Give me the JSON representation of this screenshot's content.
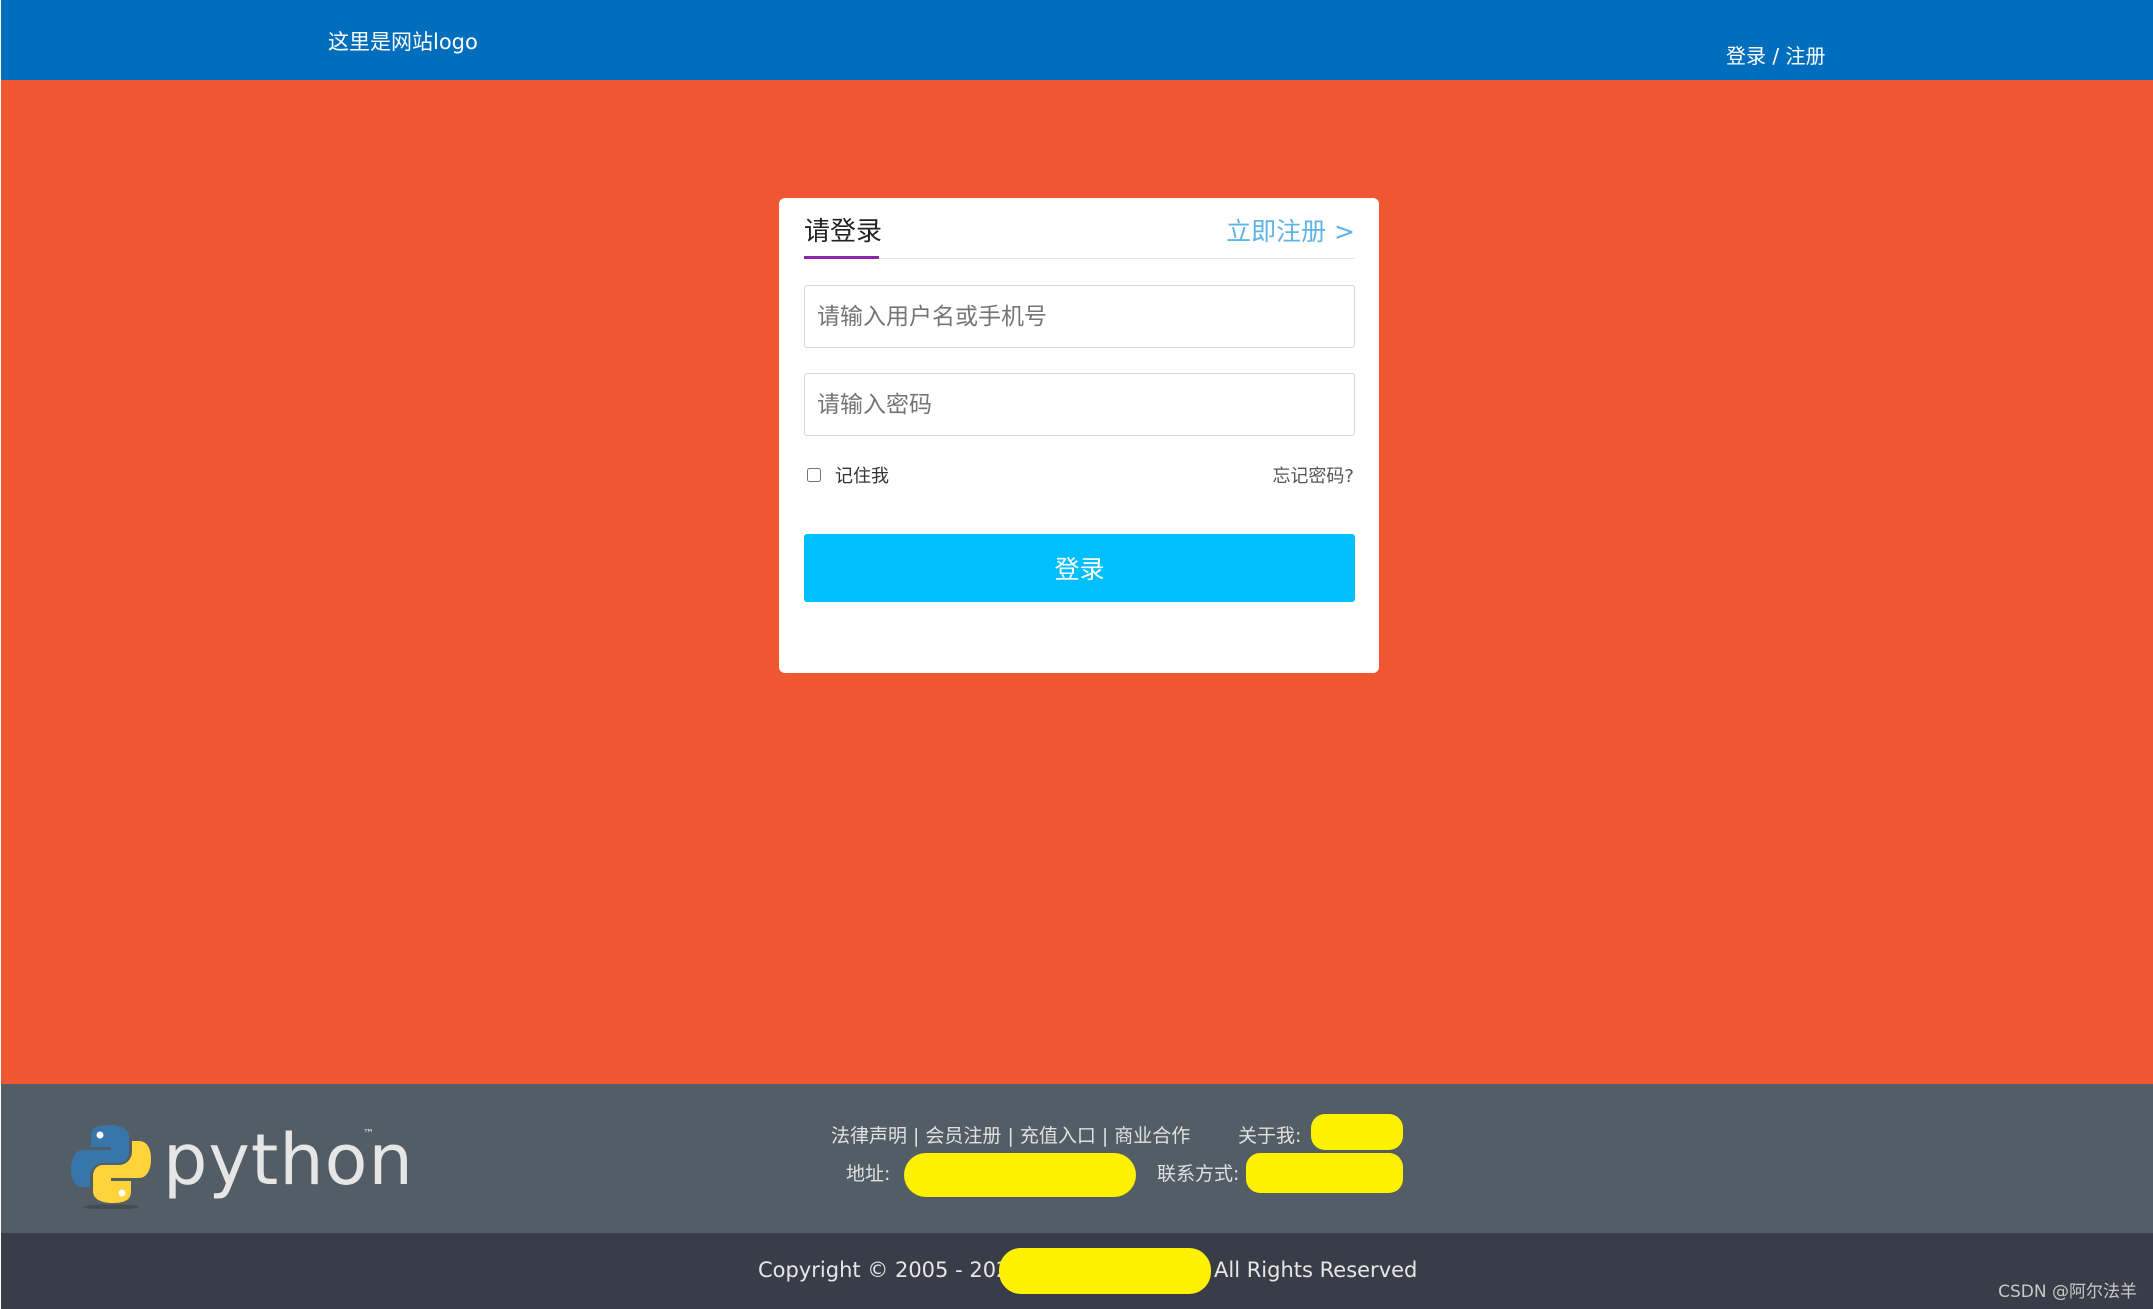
{
  "header": {
    "logo_text": "这里是网站logo",
    "login_link": "登录",
    "link_separator": " / ",
    "register_link": "注册"
  },
  "login_card": {
    "tab_login": "请登录",
    "tab_register": "立即注册 >",
    "username_placeholder": "请输入用户名或手机号",
    "password_placeholder": "请输入密码",
    "remember_label": "记住我",
    "forgot_link": "忘记密码?",
    "submit_label": "登录"
  },
  "footer": {
    "logo_wordmark": "python",
    "logo_tm": "™",
    "links": [
      "法律声明",
      "会员注册",
      "充值入口",
      "商业合作"
    ],
    "link_separator": "|",
    "about_label": "关于我:",
    "address_label": "地址:",
    "contact_label": "联系方式:",
    "copyright": "Copyright © 2005 - 2023",
    "rights": "All Rights Reserved",
    "watermark": "CSDN @阿尔法羊"
  },
  "colors": {
    "header_bg": "#006ebc",
    "main_bg": "#f15633",
    "button_bg": "#00bfff",
    "register_link": "#5fb4e6",
    "tab_accent": "#8e24aa",
    "footer_top_bg": "#535d66",
    "footer_bottom_bg": "#393d47",
    "redaction": "#fff200"
  }
}
